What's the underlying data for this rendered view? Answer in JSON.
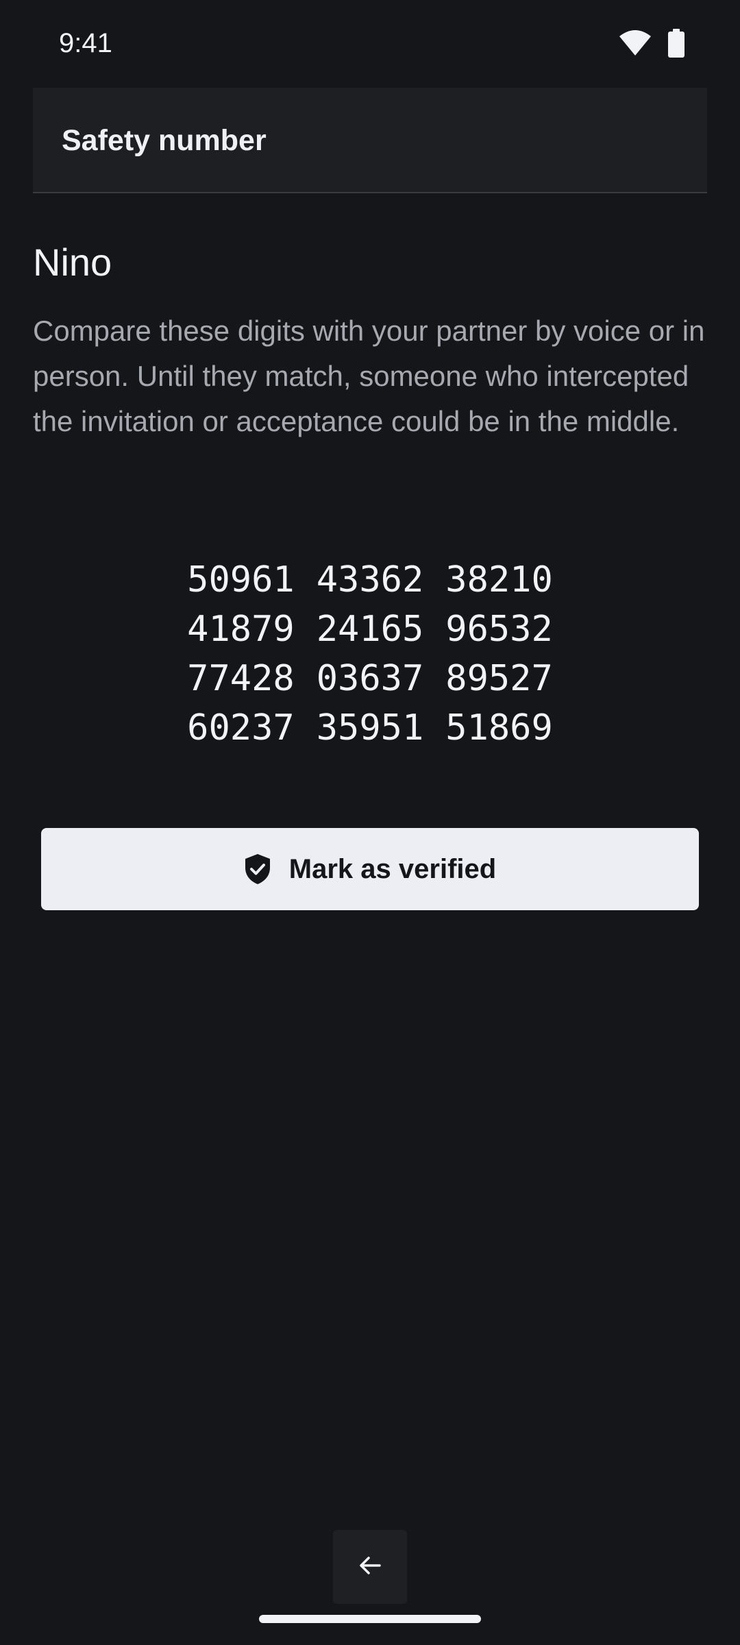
{
  "status_bar": {
    "time": "9:41",
    "wifi_icon": "wifi-icon",
    "battery_icon": "battery-icon"
  },
  "app_bar": {
    "title": "Safety number"
  },
  "contact": {
    "name": "Nino",
    "description": "Compare these digits with your partner by voice or in person. Until they match, someone who intercepted the invitation or acceptance could be in the middle."
  },
  "safety_number": {
    "rows": [
      [
        "50961",
        "43362",
        "38210"
      ],
      [
        "41879",
        "24165",
        "96532"
      ],
      [
        "77428",
        "03637",
        "89527"
      ],
      [
        "60237",
        "35951",
        "51869"
      ]
    ]
  },
  "verify_button": {
    "label": "Mark as verified",
    "icon": "shield-check-icon"
  },
  "navigation": {
    "back_icon": "arrow-left-icon"
  },
  "colors": {
    "background": "#15161a",
    "app_bar": "#1e1f22",
    "button_bg": "#eceef3",
    "text_primary": "#f2f3f6",
    "text_secondary": "#a7a9b0"
  }
}
